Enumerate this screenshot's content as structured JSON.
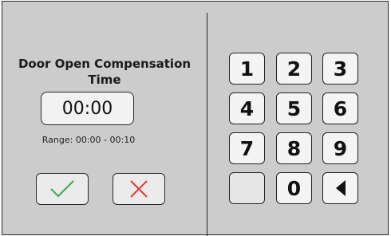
{
  "setting": {
    "title_line1": "Door Open Compensation",
    "title_line2": "Time",
    "value": "00:00",
    "range": "Range: 00:00 - 00:10"
  },
  "actions": {
    "confirm_icon": "checkmark-icon",
    "confirm_color": "#3fa34d",
    "cancel_icon": "x-icon",
    "cancel_color": "#e03a3a"
  },
  "keypad": {
    "keys": [
      "1",
      "2",
      "3",
      "4",
      "5",
      "6",
      "7",
      "8",
      "9",
      "",
      "0",
      "backspace-arrow-icon"
    ]
  }
}
